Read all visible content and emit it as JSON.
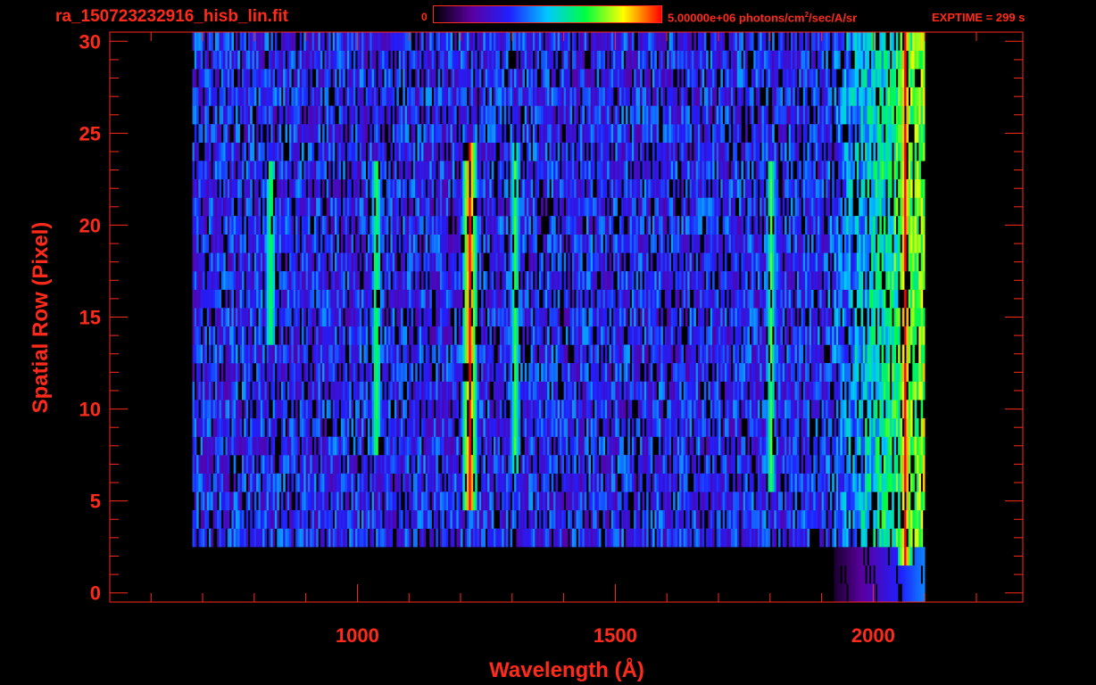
{
  "header": {
    "title": "ra_150723232916_hisb_lin.fit",
    "colorbar_min": "0",
    "colorbar_max_prefix": "5.00000e+06 photons/cm",
    "colorbar_max_sup": "2",
    "colorbar_max_suffix": "/sec/A/sr",
    "exptime": "EXPTIME = 299 s"
  },
  "colors": {
    "axis": "#ff2a1a",
    "background": "#000000",
    "colormap": [
      "#000000",
      "#5a00a0",
      "#2020ff",
      "#00c8ff",
      "#00ff40",
      "#ffff00",
      "#ff0000"
    ]
  },
  "chart_data": {
    "type": "heatmap",
    "title": "ra_150723232916_hisb_lin.fit",
    "xlabel": "Wavelength (Å)",
    "ylabel": "Spatial Row (Pixel)",
    "xlim": [
      520,
      2290
    ],
    "ylim": [
      -0.5,
      30.5
    ],
    "x_ticks": [
      1000,
      1500,
      2000
    ],
    "x_tick_labels": [
      "1000",
      "1500",
      "2000"
    ],
    "y_ticks": [
      0,
      5,
      10,
      15,
      20,
      25,
      30
    ],
    "y_tick_labels": [
      "0",
      "5",
      "10",
      "15",
      "20",
      "25",
      "30"
    ],
    "colorbar": {
      "min": 0,
      "max": 5000000,
      "min_label": "0",
      "max_label": "5.00000e+06 photons/cm²/sec/A/sr"
    },
    "exptime_s": 299,
    "signal_region": {
      "wavelength_range": [
        700,
        2060
      ],
      "row_range": [
        3,
        30
      ]
    },
    "features": [
      {
        "wavelength": 1216,
        "rows": [
          5,
          24
        ],
        "intensity": "high"
      },
      {
        "wavelength": 2060,
        "rows": [
          2,
          30
        ],
        "intensity": "high"
      },
      {
        "wavelength": 1304,
        "rows": [
          7,
          24
        ],
        "intensity": "medium"
      },
      {
        "wavelength": 1035,
        "rows": [
          8,
          23
        ],
        "intensity": "medium"
      },
      {
        "wavelength": 830,
        "rows": [
          14,
          23
        ],
        "intensity": "medium"
      },
      {
        "wavelength": 1800,
        "rows": [
          6,
          23
        ],
        "intensity": "medium"
      }
    ],
    "grid": false,
    "legend": "none"
  }
}
